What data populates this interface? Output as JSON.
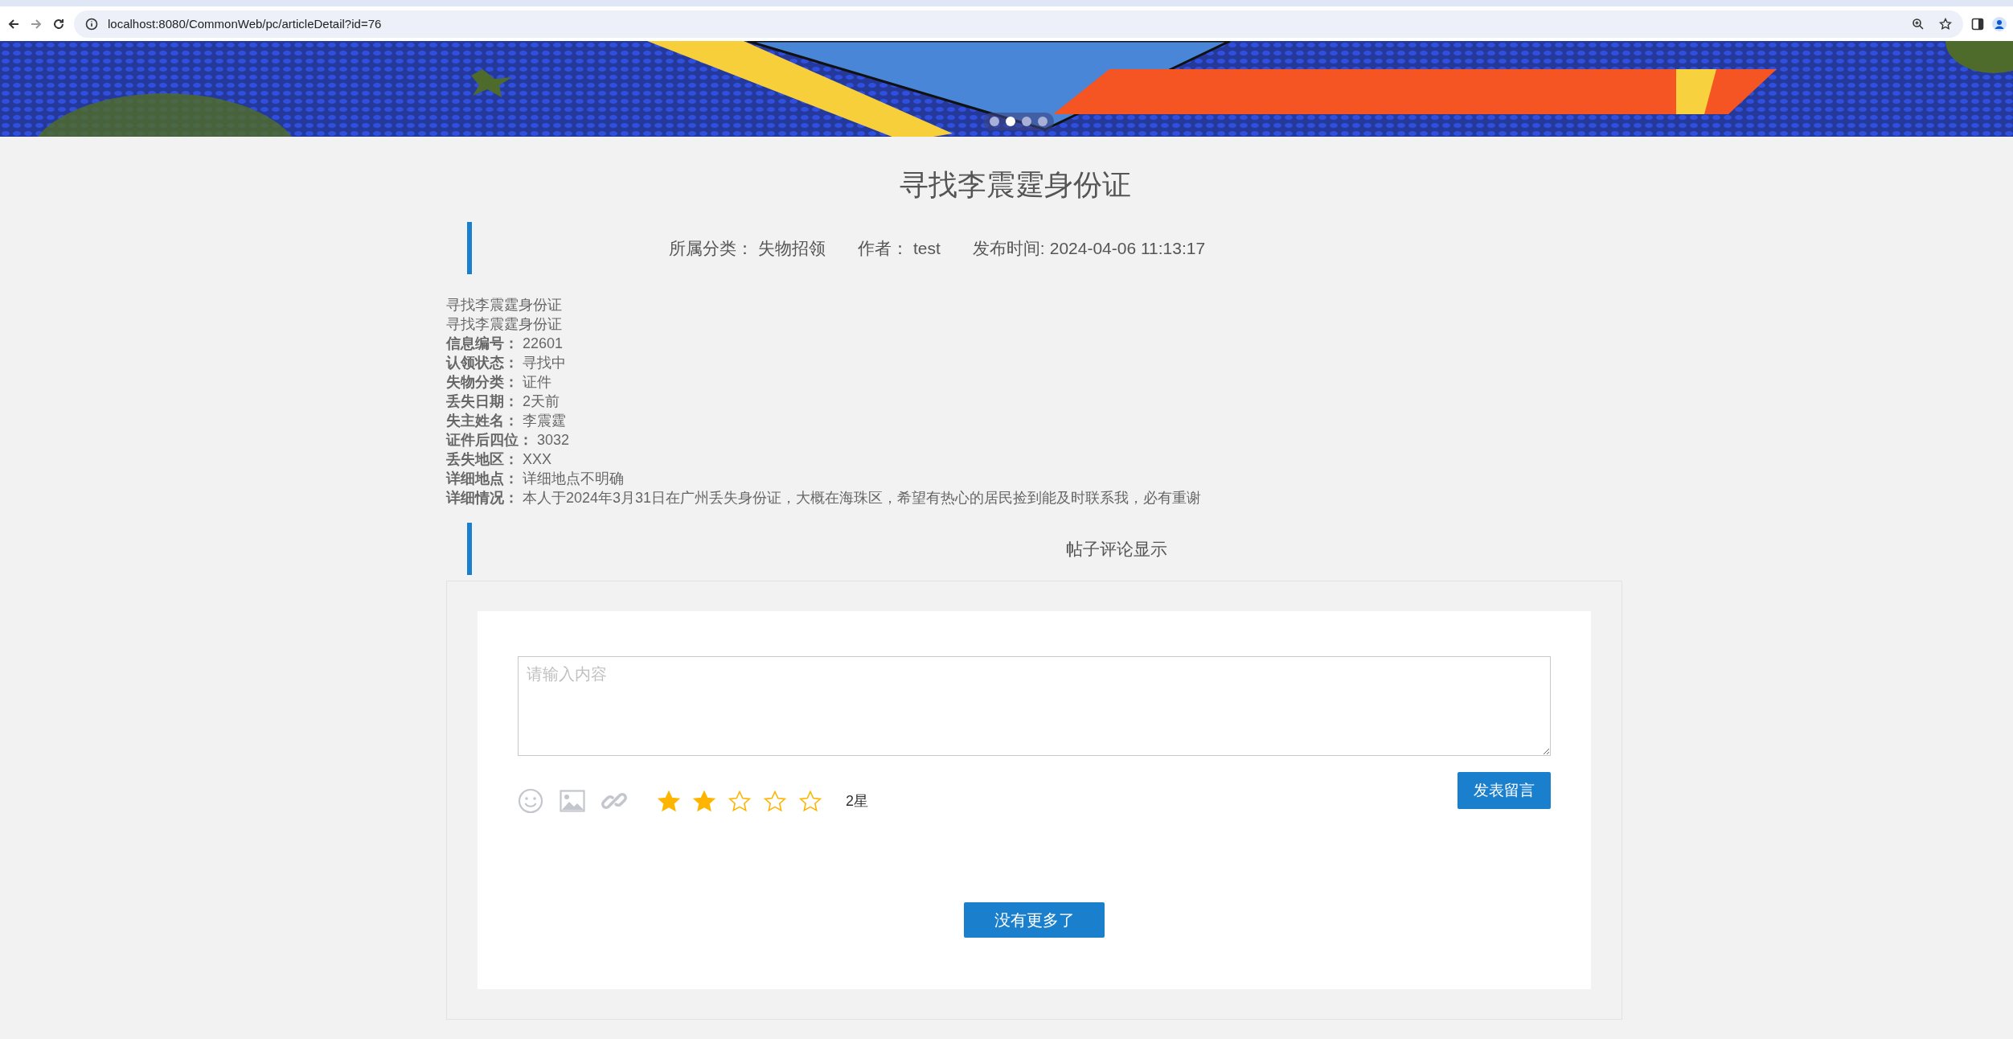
{
  "browser": {
    "url": "localhost:8080/CommonWeb/pc/articleDetail?id=76"
  },
  "banner": {
    "carousel_dots": [
      {
        "selected": false
      },
      {
        "selected": true
      },
      {
        "selected": false
      },
      {
        "selected": false
      }
    ]
  },
  "article": {
    "title": "寻找李震霆身份证",
    "meta": [
      {
        "label": "所属分类：",
        "value": "失物招领"
      },
      {
        "label": "作者：",
        "value": "test"
      },
      {
        "label": "发布时间:",
        "value": "2024-04-06 11:13:17"
      }
    ],
    "body_lines": [
      "寻找李震霆身份证",
      "寻找李震霆身份证"
    ],
    "fields": [
      {
        "label": "信息编号：",
        "value": "22601"
      },
      {
        "label": "认领状态：",
        "value": "寻找中"
      },
      {
        "label": "失物分类：",
        "value": "证件"
      },
      {
        "label": "丢失日期：",
        "value": "2天前"
      },
      {
        "label": "失主姓名：",
        "value": "李震霆"
      },
      {
        "label": "证件后四位：",
        "value": "3032"
      },
      {
        "label": "丢失地区：",
        "value": "XXX"
      },
      {
        "label": "详细地点：",
        "value": "详细地点不明确"
      },
      {
        "label": "详细情况：",
        "value": "本人于2024年3月31日在广州丢失身份证，大概在海珠区，希望有热心的居民捡到能及时联系我，必有重谢"
      }
    ]
  },
  "comments": {
    "heading": "帖子评论显示",
    "input": {
      "placeholder": "请输入内容"
    },
    "rating": {
      "stars": 2,
      "label": "2星"
    },
    "submit_button": "发表留言",
    "more_button": "没有更多了"
  }
}
